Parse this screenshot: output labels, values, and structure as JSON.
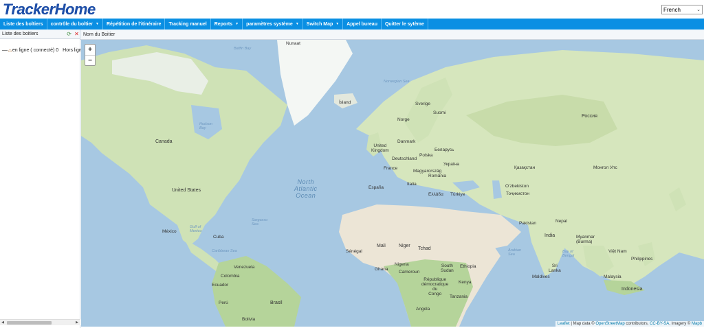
{
  "app": {
    "logo": "TrackerHome"
  },
  "language": {
    "selected": "French"
  },
  "menu": [
    {
      "label": "Liste des boîtiers",
      "dropdown": false
    },
    {
      "label": "contrôle du boîtier",
      "dropdown": true
    },
    {
      "label": "Répétition de l'itinéraire",
      "dropdown": false
    },
    {
      "label": "Tracking manuel",
      "dropdown": false
    },
    {
      "label": "Reports",
      "dropdown": true
    },
    {
      "label": "paramètres système",
      "dropdown": true
    },
    {
      "label": "Switch Map",
      "dropdown": true
    },
    {
      "label": "Appel bureau",
      "dropdown": false
    },
    {
      "label": "Quitter le sytème",
      "dropdown": false
    }
  ],
  "left": {
    "title": "Liste des boitiers",
    "tree_label": "en ligne ( connecté) 0",
    "tree_label2": "Hors lign"
  },
  "right": {
    "title": "Nom du Boitier"
  },
  "map": {
    "zoom_in": "+",
    "zoom_out": "−",
    "attribution": {
      "leaflet": "Leaflet",
      "sep1": " | Map data © ",
      "osm": "OpenStreetMap",
      "contrib": " contributors, ",
      "ccbysa": "CC-BY-SA",
      "imagery": ", Imagery © ",
      "mapbox": "Mapb"
    },
    "labels": {
      "nunaat": "Nunaat",
      "island": "Ísland",
      "canada": "Canada",
      "united_states": "United States",
      "mexico": "México",
      "cuba": "Cuba",
      "venezuela": "Venezuela",
      "colombia": "Colombia",
      "ecuador": "Ecuador",
      "peru": "Perú",
      "brasil": "Brasil",
      "bolivia": "Bolivia",
      "north_atlantic_1": "North",
      "north_atlantic_2": "Atlantic",
      "north_atlantic_3": "Ocean",
      "sverige": "Sverige",
      "suomi": "Suomi",
      "norge": "Norge",
      "danmark": "Danmark",
      "united_kingdom_1": "United",
      "united_kingdom_2": "Kingdom",
      "deutschland": "Deutschland",
      "polska": "Polska",
      "belarus": "Беларусь",
      "ukraina": "Україна",
      "france": "France",
      "magyarorszag": "Magyarország",
      "romania": "România",
      "espana": "España",
      "italia": "Italia",
      "ellada": "Ελλάδα",
      "turkiye": "Türkiye",
      "rossiya": "Россия",
      "kazakhstan": "Қазақстан",
      "mongol": "Монгол Улс",
      "uzbekiston": "Oʻzbekiston",
      "tojikiston": "Тоҷикистон",
      "pakistan": "Pakistan",
      "india": "India",
      "nepal": "Nepal",
      "myanmar": "Myanmar (Burma)",
      "viet": "Việt Nam",
      "philippines": "Philippines",
      "malaysia": "Malaysia",
      "indonesia": "Indonesia",
      "mali": "Mali",
      "niger": "Niger",
      "tchad": "Tchad",
      "senegal": "Sénégal",
      "nigeria": "Nigeria",
      "ghana": "Ghana",
      "cameroun": "Cameroun",
      "south_sudan_1": "South",
      "south_sudan_2": "Sudan",
      "ethiopia": "Ethiopia",
      "kenya": "Kenya",
      "rdc_1": "République",
      "rdc_2": "démocratique",
      "rdc_3": "du",
      "rdc_4": "Congo",
      "tanzania": "Tanzania",
      "angola": "Angola",
      "maldives": "Maldives",
      "sri_lanka_1": "Sri",
      "sri_lanka_2": "Lanka",
      "gulf_of_mexico": "Gulf of Mexico",
      "caribbean_sea": "Caribbean Sea",
      "sargasso_sea": "Sargasso Sea",
      "arabian_sea": "Arabian Sea",
      "bay_of_bengal": "Bay of Bengal",
      "norwegian_sea": "Norwegian Sea",
      "hudson_bay": "Hudson Bay",
      "baffin_bay": "Baffin Bay"
    }
  }
}
